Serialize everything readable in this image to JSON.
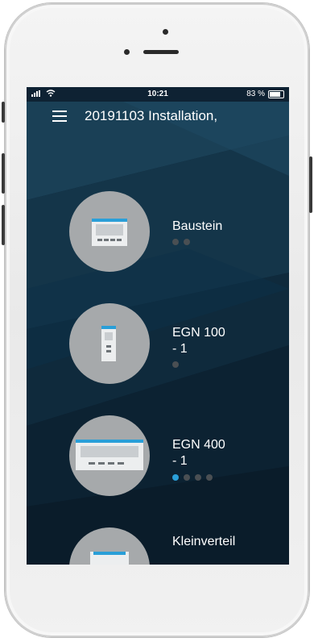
{
  "status_bar": {
    "time": "10:21",
    "battery_text": "83 %",
    "battery_level": 0.83
  },
  "header": {
    "title": "20191103 Installation,"
  },
  "devices": [
    {
      "name_line1": "Baustein",
      "name_line2": "",
      "page_count": 2,
      "active_index": -1,
      "icon": "module-device-icon"
    },
    {
      "name_line1": "EGN 100",
      "name_line2": "- 1",
      "page_count": 1,
      "active_index": -1,
      "icon": "din-rail-device-icon"
    },
    {
      "name_line1": "EGN 400",
      "name_line2": "- 1",
      "page_count": 4,
      "active_index": 0,
      "icon": "wide-device-icon"
    },
    {
      "name_line1": "Kleinverteil",
      "name_line2": "",
      "page_count": 0,
      "active_index": -1,
      "icon": "distribution-box-icon"
    }
  ],
  "colors": {
    "accent": "#2a9fd8",
    "background": "#0e2233",
    "circle": "#a6a9ab"
  }
}
